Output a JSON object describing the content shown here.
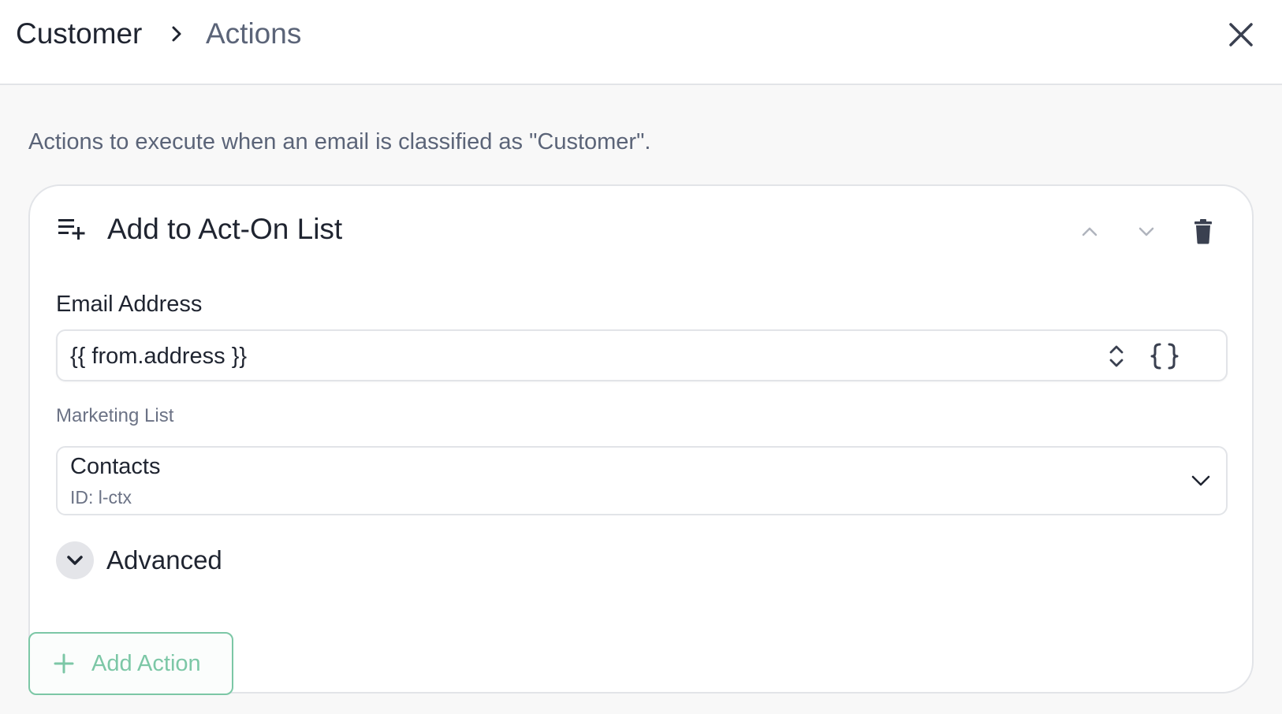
{
  "header": {
    "breadcrumb_root": "Customer",
    "breadcrumb_current": "Actions"
  },
  "description": "Actions to execute when an email is classified as \"Customer\".",
  "action_card": {
    "title": "Add to Act-On List",
    "icon": "playlist-add-icon",
    "fields": {
      "email_address": {
        "label": "Email Address",
        "value": "{{ from.address }}"
      },
      "marketing_list": {
        "label": "Marketing List",
        "selected_value": "Contacts",
        "selected_sub": "ID: l-ctx"
      }
    },
    "advanced_label": "Advanced"
  },
  "add_action_label": "Add Action",
  "colors": {
    "accent": "#7cc7a6",
    "text_primary": "#1f2430",
    "text_secondary": "#5b6478",
    "border": "#e2e4e8"
  }
}
